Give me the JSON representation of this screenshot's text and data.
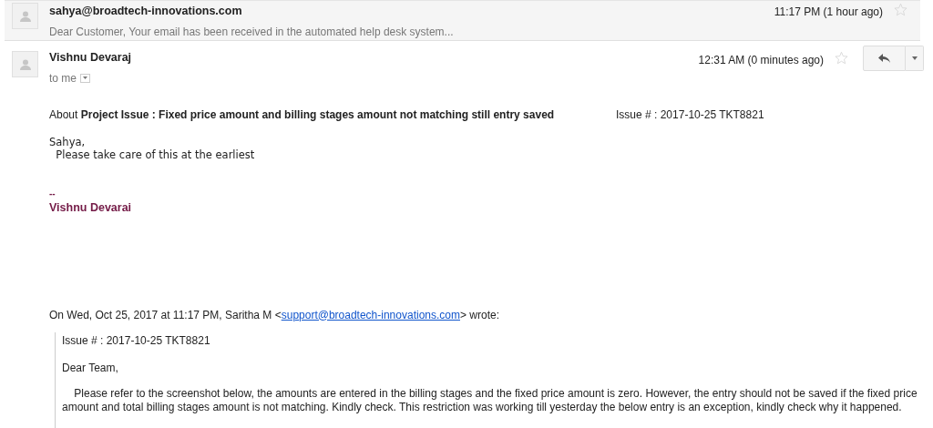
{
  "collapsed_message": {
    "sender": "sahya@broadtech-innovations.com",
    "snippet": "Dear Customer, Your email has been received in the automated help desk system...",
    "time": "11:17 PM (1 hour ago)",
    "starred": false
  },
  "message": {
    "sender": "Vishnu Devaraj",
    "recipient": "to me",
    "time": "12:31 AM (0 minutes ago)",
    "starred": false,
    "about_label": "About",
    "subject": "Project Issue : Fixed price amount and billing stages amount not matching still entry saved",
    "issue": "Issue # : 2017-10-25 TKT8821",
    "greeting": "Sahya,",
    "body": "  Please take care of this at the earliest",
    "signature_dash": "--",
    "signature_name": "Vishnu Devarai",
    "quote_header": {
      "before": "On Wed, Oct 25, 2017 at 11:17 PM, Saritha M <",
      "link": "support@broadtech-innovations.com",
      "after": "> wrote:"
    },
    "quote": {
      "issue": "Issue # : 2017-10-25 TKT8821",
      "greeting": "Dear Team,",
      "paragraph": "    Please refer to the screenshot below, the amounts are entered in the billing stages and the fixed price amount is zero. However, the entry should not be saved if the fixed price amount and total billing stages amount is not matching. Kindly check. This restriction was working till yesterday the below entry is an exception, kindly check why it happened."
    }
  }
}
